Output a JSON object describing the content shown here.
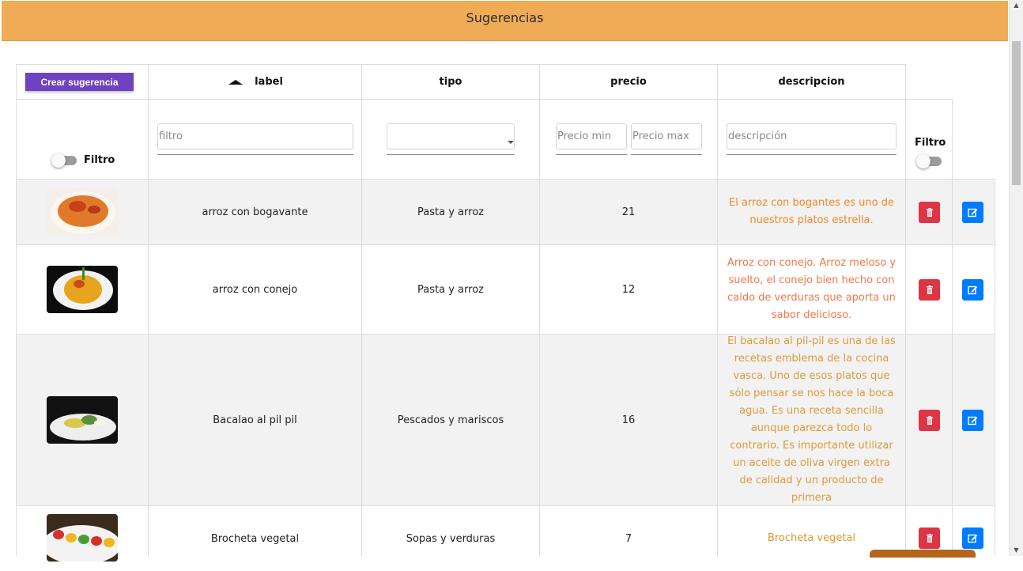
{
  "header": {
    "title": "Sugerencias"
  },
  "toolbar": {
    "create_label": "Crear sugerencia"
  },
  "columns": {
    "label": "label",
    "tipo": "tipo",
    "precio": "precio",
    "descripcion": "descripcion"
  },
  "filters": {
    "toggle_label": "Filtro",
    "filtro_placeholder": "filtro",
    "tipo_selected": "",
    "precio_min_placeholder": "Precio min",
    "precio_max_placeholder": "Precio max",
    "descripcion_placeholder": "descripción",
    "right_toggle_label": "Filtro"
  },
  "rows": [
    {
      "label": "arroz con bogavante",
      "tipo": "Pasta y arroz",
      "precio": "21",
      "descripcion": "El arroz con bogantes es uno de nuestros platos estrella.",
      "desc_color": "#f08a24"
    },
    {
      "label": "arroz con conejo",
      "tipo": "Pasta y arroz",
      "precio": "12",
      "descripcion": "Arroz con conejo. Arroz meloso y suelto, el conejo bien hecho con caldo de verduras que aporta un sabor delicioso.",
      "desc_color": "#f0784a"
    },
    {
      "label": "Bacalao al pil pil",
      "tipo": "Pescados y mariscos",
      "precio": "16",
      "descripcion": "El bacalao al pil-pil es una de las recetas emblema de la cocina vasca. Uno de esos platos que sólo pensar se nos hace la boca agua. Es una receta sencilla aunque parezca todo lo contrario. Es importante utilizar un aceite de oliva virgen extra de calidad y un producto de primera",
      "desc_color": "#e09a3c"
    },
    {
      "label": "Brocheta vegetal",
      "tipo": "Sopas y verduras",
      "precio": "7",
      "descripcion": "Brocheta vegetal",
      "desc_color": "#e0962e"
    }
  ],
  "colors": {
    "header_bg": "#f0ab57",
    "create_button": "#6f42c1",
    "delete_button": "#dc3545",
    "edit_button": "#007bff"
  },
  "icons": {
    "delete": "trash-icon",
    "edit": "edit-icon",
    "sort": "sort-ascending-icon"
  }
}
